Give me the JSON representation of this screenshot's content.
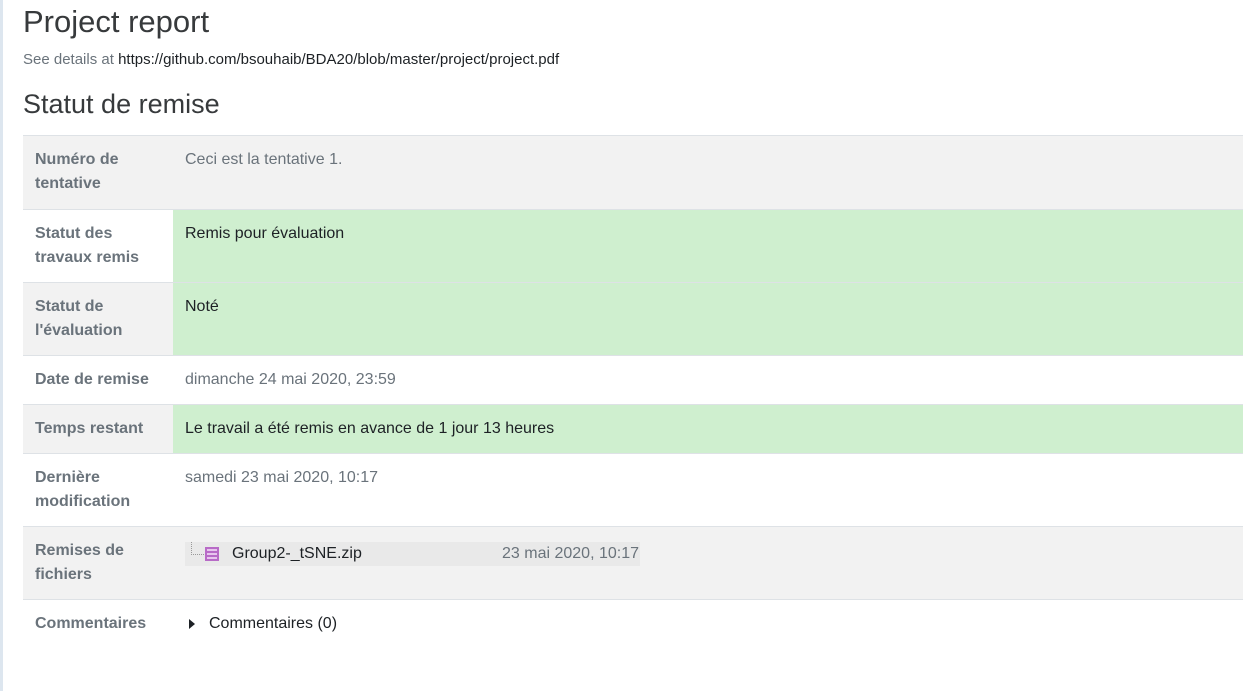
{
  "header": {
    "title": "Project report",
    "details_prefix": "See details at ",
    "details_link": "https://github.com/bsouhaib/BDA20/blob/master/project/project.pdf"
  },
  "section": {
    "title": "Statut de remise"
  },
  "rows": {
    "attempt": {
      "label": "Numéro de tentative",
      "value": "Ceci est la tentative 1."
    },
    "submission_status": {
      "label": "Statut des travaux remis",
      "value": "Remis pour évaluation"
    },
    "grading_status": {
      "label": "Statut de l'évaluation",
      "value": "Noté"
    },
    "due_date": {
      "label": "Date de remise",
      "value": "dimanche 24 mai 2020, 23:59"
    },
    "time_remaining": {
      "label": "Temps restant",
      "value": "Le travail a été remis en avance de 1 jour 13 heures"
    },
    "last_modified": {
      "label": "Dernière modification",
      "value": "samedi 23 mai 2020, 10:17"
    },
    "file_submissions": {
      "label": "Remises de fichiers",
      "file_name": "Group2-_tSNE.zip",
      "file_date": "23 mai 2020, 10:17",
      "file_icon": "archive-zip-icon"
    },
    "comments": {
      "label": "Commentaires",
      "toggle": "Commentaires (0)"
    }
  },
  "colors": {
    "success_bg": "#cfefcf",
    "stripe_bg": "#f2f2f2",
    "muted_text": "#6a737b"
  }
}
